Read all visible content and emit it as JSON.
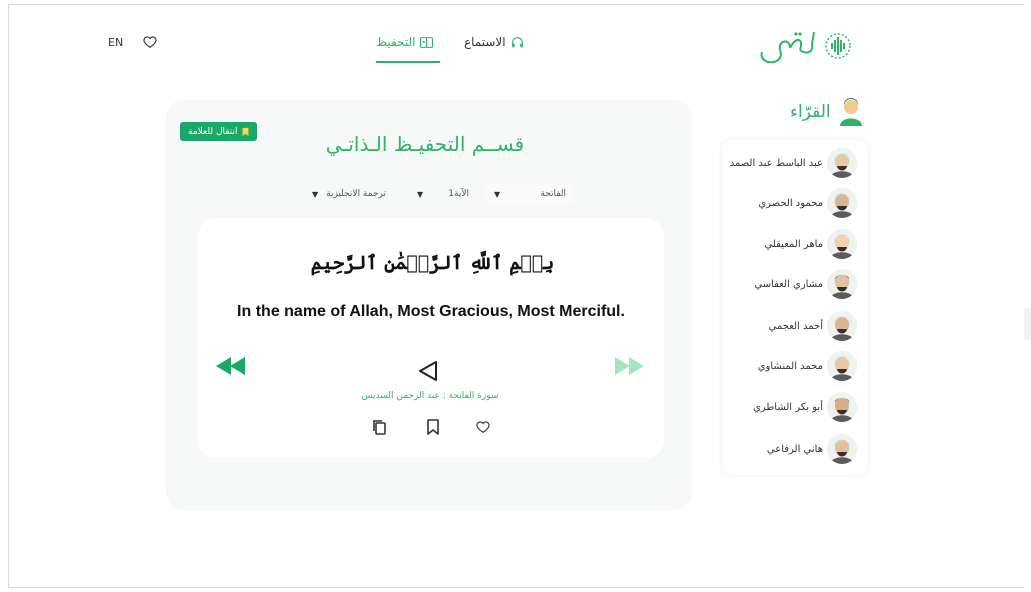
{
  "nav": {
    "lang": "EN",
    "hifz_label": "التحفيظ",
    "listen_label": "الاستماع",
    "logo_text": "رتل"
  },
  "main": {
    "goto_mark_label": "انتقال للعلامة",
    "section_title": "قســم التحفيـظ الـذاتـي",
    "selects": {
      "surah": "الفاتحة",
      "ayah": "الآية1",
      "translation": "ترجمة الانجليزية"
    },
    "verse_arabic": "بِسۡمِ ٱللَّهِ ٱلرَّحۡمَٰنِ ٱلرَّحِيمِ",
    "verse_translation": "In the name of Allah, Most Gracious, Most Merciful.",
    "caption": "سورة الفاتحة : عبد الرحمن السديس"
  },
  "reciters": {
    "title": "القرّاء",
    "items": [
      {
        "name": "عبد الباسط عبد الصمد"
      },
      {
        "name": "محمود الحصري"
      },
      {
        "name": "ماهر المعيقلي"
      },
      {
        "name": "مشاري العفاسي"
      },
      {
        "name": "أحمد العجمي"
      },
      {
        "name": "محمد المنشاوي"
      },
      {
        "name": "أبو بكر الشاطري"
      },
      {
        "name": "هاني الرفاعي"
      }
    ]
  },
  "colors": {
    "brand_green": "#2fb36b",
    "button_green": "#1aa866"
  },
  "icons": {
    "nav_favorite": "heart-icon",
    "nav_hifz": "book-icon",
    "nav_listen": "headphones-icon",
    "goto_mark": "bookmark-icon",
    "prev": "rewind-icon",
    "play": "play-icon",
    "next": "fast-forward-icon",
    "copy": "copy-icon",
    "bookmark": "bookmark-icon",
    "favorite": "heart-icon",
    "reciters_header": "user-icon"
  }
}
